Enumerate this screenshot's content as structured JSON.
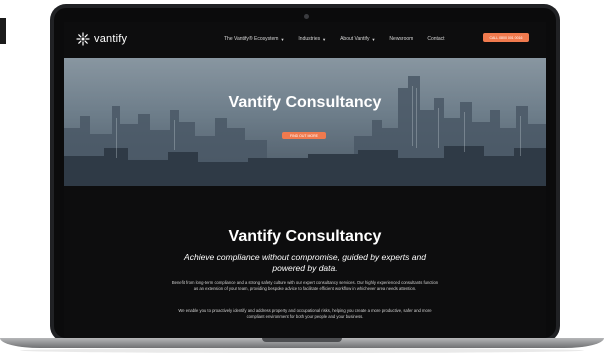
{
  "navbar": {
    "brand": "vantify",
    "links": [
      {
        "label": "The Vantify® Ecosystem",
        "has_dropdown": true
      },
      {
        "label": "Industries",
        "has_dropdown": true
      },
      {
        "label": "About Vantify",
        "has_dropdown": true
      },
      {
        "label": "Newsroom",
        "has_dropdown": false
      },
      {
        "label": "Contact",
        "has_dropdown": false
      }
    ],
    "cta_label": "CALL 0800 001 0016"
  },
  "hero": {
    "title": "Vantify Consultancy",
    "button_label": "FIND OUT MORE"
  },
  "content": {
    "title": "Vantify Consultancy",
    "subtitle": "Achieve compliance without compromise, guided by experts and powered by data.",
    "paragraph_1": "Benefit from long-term compliance and a strong safety culture with our expert consultancy services. Our highly experienced consultants function as an extension of your team, providing bespoke advice to facilitate efficient workflow in whichever area needs attention.",
    "paragraph_2": "We enable you to proactively identify and address property and occupational risks, helping you create a more productive, safer and more compliant environment for both your people and your business."
  },
  "colors": {
    "accent": "#f07a4e",
    "background": "#0d0d0e",
    "text": "#ffffff"
  }
}
